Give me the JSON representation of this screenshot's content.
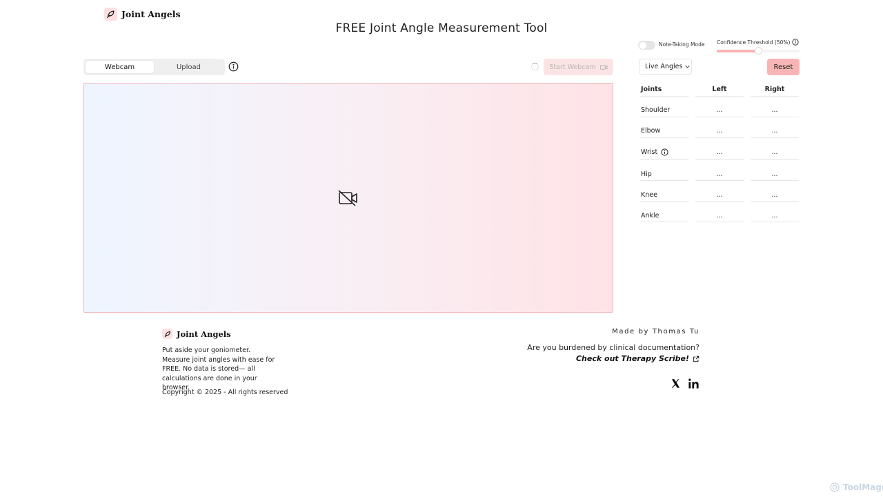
{
  "brand": {
    "name": "Joint Angels"
  },
  "page": {
    "title": "FREE Joint Angle Measurement Tool"
  },
  "tabs": [
    {
      "label": "Webcam",
      "active": true
    },
    {
      "label": "Upload",
      "active": false
    }
  ],
  "webcam": {
    "start_label": "Start Webcam"
  },
  "settings": {
    "note_taking_label": "Note-Taking Mode",
    "note_taking_on": false,
    "confidence_label": "Confidence Threshold (50%)",
    "confidence_value": 0.5,
    "view_select": "Live Angles",
    "reset_label": "Reset"
  },
  "table": {
    "headers": [
      "Joints",
      "Left",
      "Right"
    ],
    "rows": [
      {
        "joint": "Shoulder",
        "left": "...",
        "right": "..."
      },
      {
        "joint": "Elbow",
        "left": "...",
        "right": "..."
      },
      {
        "joint": "Wrist",
        "left": "...",
        "right": "..."
      },
      {
        "joint": "Hip",
        "left": "...",
        "right": "..."
      },
      {
        "joint": "Knee",
        "left": "...",
        "right": "..."
      },
      {
        "joint": "Ankle",
        "left": "...",
        "right": "..."
      }
    ]
  },
  "footer": {
    "brand": "Joint Angels",
    "description": "Put aside your goniometer. Measure joint angles with ease for FREE. No data is stored— all calculations are done in your browser.",
    "copyright": "Copyright © 2025 - All rights reserved",
    "made_by": "Made by Thomas Tu",
    "burden_question": "Are you burdened by clinical documentation?",
    "scribe_link": "Check out Therapy Scribe!"
  },
  "watermark": "ToolMage",
  "colors": {
    "accent": "#f9b5b5",
    "accent_light": "#fde4e4",
    "border_pink": "#f1b8b8"
  },
  "icons": [
    "feather-logo-icon",
    "info-icon",
    "video-camera-icon",
    "video-off-icon",
    "chevron-down-icon",
    "external-link-icon",
    "x-logo-icon",
    "linkedin-icon"
  ]
}
